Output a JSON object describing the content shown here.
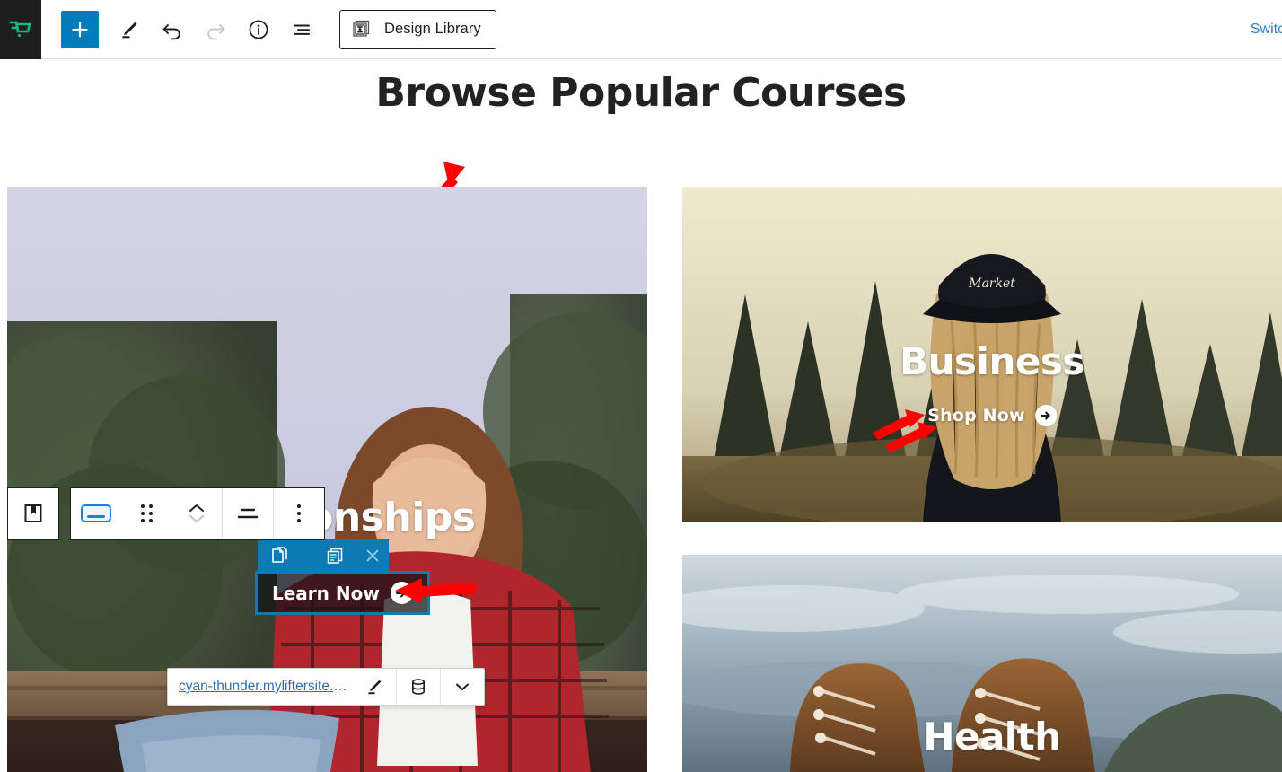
{
  "topbar": {
    "brand_icon": "shopping-cart-icon",
    "buttons": [
      {
        "name": "add-block-button",
        "icon": "plus-icon",
        "label": "Add block"
      },
      {
        "name": "edit-tool-button",
        "icon": "pencil-icon",
        "label": "Edit"
      },
      {
        "name": "undo-button",
        "icon": "undo-arrow-icon",
        "label": "Undo"
      },
      {
        "name": "redo-button",
        "icon": "redo-arrow-icon",
        "label": "Redo"
      },
      {
        "name": "details-button",
        "icon": "info-circle-icon",
        "label": "Details"
      },
      {
        "name": "list-view-button",
        "icon": "list-view-icon",
        "label": "List View"
      }
    ],
    "design_library": {
      "label": "Design Library",
      "icon": "design-library-icon"
    },
    "switch_link": "Switch",
    "accent_blue": "#007cba",
    "brand_green": "#12b886"
  },
  "canvas": {
    "heading": "Browse Popular Courses",
    "cards": [
      {
        "name": "card-relationships",
        "title": "Relationships",
        "title_visible_fragment": "ionships",
        "cta_label": "Learn Now",
        "cta_icon": "arrow-right-circle-icon",
        "selected": true
      },
      {
        "name": "card-business",
        "title": "Business",
        "cta_label": "Shop Now",
        "cta_icon": "arrow-right-circle-icon",
        "selected": false
      },
      {
        "name": "card-health",
        "title": "Health",
        "cta_label": "",
        "cta_icon": "",
        "selected": false
      }
    ]
  },
  "block_toolbar": {
    "items": [
      {
        "name": "block-type-button",
        "icon": "bookmark-block-icon"
      },
      {
        "name": "button-style-selector",
        "icon": "button-pill-icon"
      },
      {
        "name": "drag-handle",
        "icon": "drag-dots-icon"
      },
      {
        "name": "move-updown-button",
        "icon": "chevron-up-down-icon"
      },
      {
        "name": "align-button",
        "icon": "align-center-icon"
      },
      {
        "name": "more-options-button",
        "icon": "vertical-dots-icon"
      }
    ]
  },
  "mini_toolbar": {
    "accent": "#0b7ab5",
    "items": [
      {
        "name": "copy-block-button",
        "icon": "copy-pages-icon"
      },
      {
        "name": "duplicate-block-button",
        "icon": "duplicate-icon"
      },
      {
        "name": "close-button",
        "icon": "close-x-icon"
      }
    ]
  },
  "link_popover": {
    "url": "cyan-thunder.myliftersite.co…",
    "edit_icon": "pencil-icon",
    "database_icon": "database-icon",
    "expand_icon": "chevron-down-icon"
  },
  "annotations": {
    "color": "#ff0000",
    "arrows": [
      {
        "name": "arrow-to-heading",
        "points_at": "Browse Popular Courses"
      },
      {
        "name": "arrow-to-business",
        "points_at": "Business"
      },
      {
        "name": "arrow-to-shop-now",
        "points_at": "Shop Now"
      },
      {
        "name": "arrow-to-learn-now",
        "points_at": "Learn Now"
      }
    ]
  }
}
